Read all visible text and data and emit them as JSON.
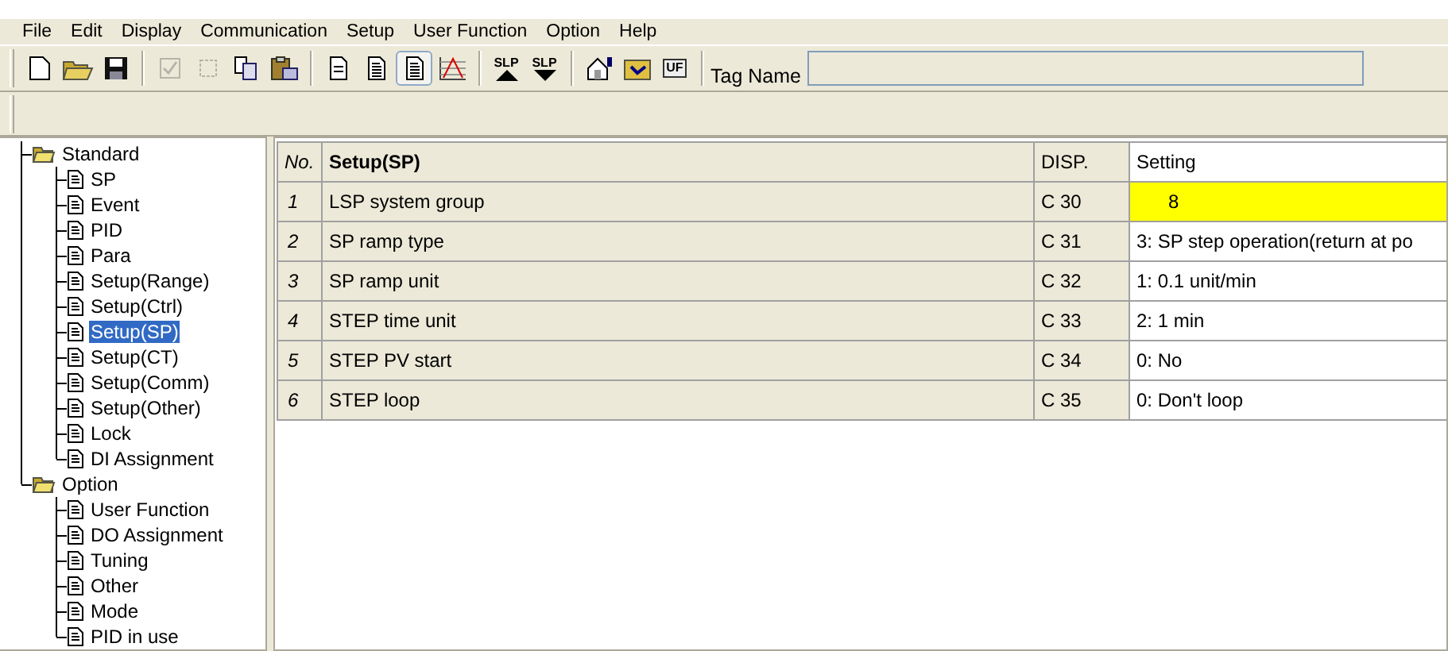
{
  "menu": [
    "File",
    "Edit",
    "Display",
    "Communication",
    "Setup",
    "User Function",
    "Option",
    "Help"
  ],
  "toolbar": [
    {
      "kind": "new",
      "disabled": false,
      "pressed": false
    },
    {
      "kind": "open",
      "disabled": false,
      "pressed": false
    },
    {
      "kind": "save",
      "disabled": false,
      "pressed": false
    },
    {
      "kind": "sep"
    },
    {
      "kind": "check",
      "disabled": true,
      "pressed": false
    },
    {
      "kind": "frame",
      "disabled": true,
      "pressed": false
    },
    {
      "kind": "copy",
      "disabled": false,
      "pressed": false
    },
    {
      "kind": "paste",
      "disabled": false,
      "pressed": false
    },
    {
      "kind": "sep"
    },
    {
      "kind": "doc",
      "disabled": false,
      "pressed": false
    },
    {
      "kind": "doclines",
      "disabled": false,
      "pressed": false
    },
    {
      "kind": "doclines",
      "disabled": false,
      "pressed": true
    },
    {
      "kind": "chart",
      "disabled": false,
      "pressed": false
    },
    {
      "kind": "sep"
    },
    {
      "kind": "upload",
      "text": "SLP",
      "disabled": false,
      "pressed": false
    },
    {
      "kind": "download",
      "text": "SLP",
      "disabled": false,
      "pressed": false
    },
    {
      "kind": "sep"
    },
    {
      "kind": "properties",
      "disabled": false,
      "pressed": false
    },
    {
      "kind": "folder",
      "disabled": false,
      "pressed": false
    },
    {
      "kind": "uf",
      "text": "UF",
      "disabled": false,
      "pressed": false
    },
    {
      "kind": "sep"
    }
  ],
  "tag_name": {
    "label": "Tag Name"
  },
  "tree": [
    {
      "label": "Standard",
      "selected": false,
      "children": [
        {
          "label": "SP",
          "selected": false
        },
        {
          "label": "Event",
          "selected": false
        },
        {
          "label": "PID",
          "selected": false
        },
        {
          "label": "Para",
          "selected": false
        },
        {
          "label": "Setup(Range)",
          "selected": false
        },
        {
          "label": "Setup(Ctrl)",
          "selected": false
        },
        {
          "label": "Setup(SP)",
          "selected": true
        },
        {
          "label": "Setup(CT)",
          "selected": false
        },
        {
          "label": "Setup(Comm)",
          "selected": false
        },
        {
          "label": "Setup(Other)",
          "selected": false
        },
        {
          "label": "Lock",
          "selected": false
        },
        {
          "label": "DI Assignment",
          "selected": false
        }
      ]
    },
    {
      "label": "Option",
      "selected": false,
      "children": [
        {
          "label": "User Function",
          "selected": false
        },
        {
          "label": "DO Assignment",
          "selected": false
        },
        {
          "label": "Tuning",
          "selected": false
        },
        {
          "label": "Other",
          "selected": false
        },
        {
          "label": "Mode",
          "selected": false
        },
        {
          "label": "PID in use",
          "selected": false
        }
      ]
    }
  ],
  "table": {
    "columns": [
      "No.",
      "Setup(SP)",
      "DISP.",
      "Setting"
    ],
    "rows": [
      {
        "no": "1",
        "name": "LSP system group",
        "disp": "C 30",
        "setting": "8",
        "selected": true
      },
      {
        "no": "2",
        "name": "SP ramp type",
        "disp": "C 31",
        "setting": "3: SP step operation(return at po",
        "selected": false
      },
      {
        "no": "3",
        "name": "SP ramp unit",
        "disp": "C 32",
        "setting": "1: 0.1 unit/min",
        "selected": false
      },
      {
        "no": "4",
        "name": "STEP time unit",
        "disp": "C 33",
        "setting": "2: 1 min",
        "selected": false
      },
      {
        "no": "5",
        "name": "STEP PV start",
        "disp": "C 34",
        "setting": "0: No",
        "selected": false
      },
      {
        "no": "6",
        "name": "STEP loop",
        "disp": "C 35",
        "setting": "0: Don't loop",
        "selected": false
      }
    ]
  }
}
